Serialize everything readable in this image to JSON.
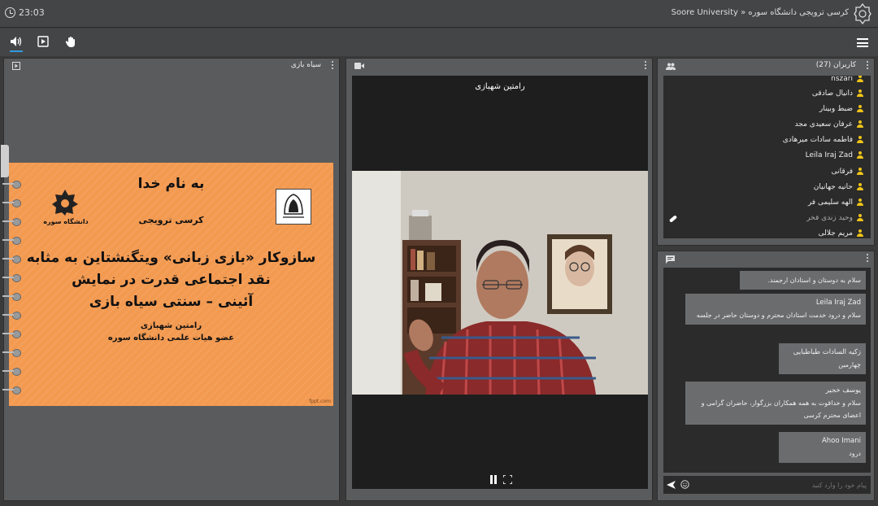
{
  "topbar": {
    "time": "23:03",
    "breadcrumb": "Soore University » کرسی ترویجی دانشگاه سوره"
  },
  "toolbar": {
    "audio_icon": "speaker-icon",
    "screen_icon": "screen-share-icon",
    "hand_icon": "raise-hand-icon",
    "menu_icon": "hamburger-menu-icon"
  },
  "presentation": {
    "title": "سیاه بازی",
    "slide": {
      "line1": "به نام خدا",
      "line2": "کرسی ترویجی",
      "title_line1": "سازوکار «بازی زبانی» ویتگنشتاین به مثابه",
      "title_line2": "نقد اجتماعی قدرت در نمایش",
      "title_line3": "آئینی – سنتی سیاه بازی",
      "presenter": "رامتین شهبازی",
      "affiliation": "عضو هیات علمی دانشگاه سوره",
      "logo_text": "دانشگاه سوره",
      "footer": "fppt.com"
    }
  },
  "video": {
    "name": "رامتین شهبازی"
  },
  "users": {
    "title": "کاربران (27)",
    "list": [
      "nszari",
      "دانیال صادقی",
      "ضبط وبینار",
      "عرفان سعیدی مجد",
      "فاطمه سادات میرهادی",
      "Leila Iraj Zad",
      "فرقانی",
      "حانیه جهانیان",
      "الهه سلیمی فر",
      "وحید زندی فخر",
      "مریم جلالی"
    ]
  },
  "chat": {
    "messages": [
      {
        "name": "",
        "text": "سلام به دوستان و استادان ارجمند."
      },
      {
        "name": "Leila Iraj Zad",
        "text": "سلام و درود خدمت استادان محترم و دوستان حاضر در جلسه"
      },
      {
        "name": "زکیه السادات طباطبایی",
        "text": "چهارمین"
      },
      {
        "name": "یوسف خجیر",
        "text": "سلام و خداقوت به همه همکاران بزرگوار، حاضران گرامی و اعضای محترم کرسی"
      },
      {
        "name": "Ahoo Imani",
        "text": "درود"
      }
    ],
    "placeholder": "پیام خود را وارد کنید"
  },
  "colors": {
    "accent": "#2f9be0",
    "slide_bg": "#f39a51",
    "user_icon": "#f0c419"
  }
}
